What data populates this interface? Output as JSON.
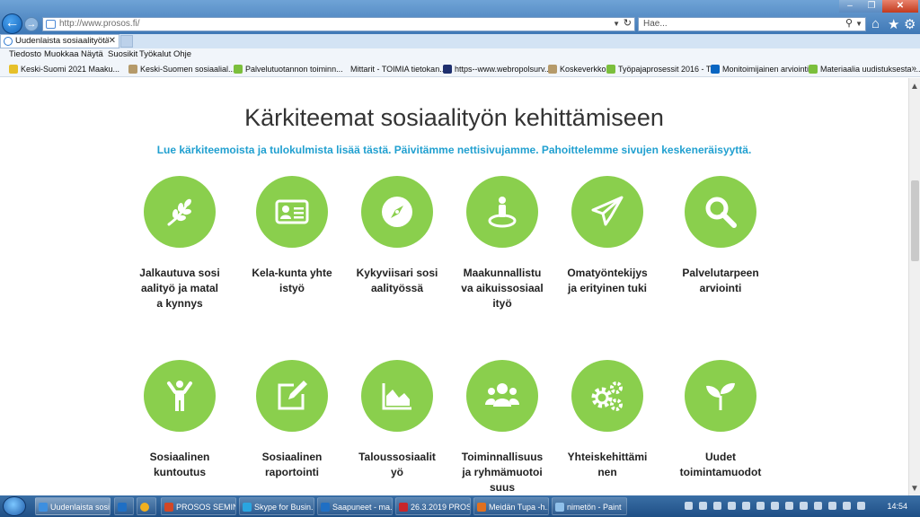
{
  "browser": {
    "url": "http://www.prosos.fi/",
    "search_placeholder": "Hae...",
    "tab_title": "Uudenlaista sosiaalityötä yh...",
    "menu": [
      "Tiedosto",
      "Muokkaa",
      "Näytä",
      "Suosikit",
      "Työkalut",
      "Ohje"
    ],
    "favorites": [
      "Keski-Suomi 2021  Maaku...",
      "Keski-Suomen sosiaalial...",
      "Palvelutuotannon toiminn...",
      "Mittarit - TOIMIA tietokan...",
      "https--www.webropolsurv...",
      "Koskeverkko",
      "Työpajaprosessit 2016 - T...",
      "Monitoimijainen arviointi",
      "Materiaalia uudistuksesta ..."
    ],
    "accent_color": "#3f78b6"
  },
  "page": {
    "heading": "Kärkiteemat sosiaalityön kehittämiseen",
    "intro": "Lue kärkiteemoista ja tulokulmista lisää tästä. Päivitämme nettisivujamme. Pahoittelemme sivujen keskeneräisyyttä.",
    "theme_color": "#8acf4d",
    "intro_color": "#21a0d0",
    "items": [
      {
        "label": "Jalkautuva sosiaalityö ja matala kynnys",
        "icon": "plant-branch-icon"
      },
      {
        "label": "Kela-kunta yhteistyö",
        "icon": "id-card-icon"
      },
      {
        "label": "Kykyviisari sosiaalityössä",
        "icon": "compass-icon"
      },
      {
        "label": "Maakunnallistuva aikuissosiaalityö",
        "icon": "person-location-icon"
      },
      {
        "label": "Omatyöntekijys ja erityinen tuki",
        "icon": "paper-plane-icon"
      },
      {
        "label": "Palvelutarpeen arviointi",
        "icon": "magnifier-icon"
      },
      {
        "label": "Sosiaalinen kuntoutus",
        "icon": "person-arms-up-icon"
      },
      {
        "label": "Sosiaalinen raportointi",
        "icon": "edit-icon"
      },
      {
        "label": "Taloussosiaalityö",
        "icon": "area-chart-icon"
      },
      {
        "label": "Toiminnallisuus ja ryhmämuotoisuus",
        "icon": "group-icon"
      },
      {
        "label": "Yhteiskehittäminen",
        "icon": "gears-icon"
      },
      {
        "label": "Uudet toimintamuodot",
        "icon": "sprout-icon"
      }
    ]
  },
  "taskbar": {
    "windows": [
      "Uudenlaista sosi...",
      "PROSOS SEMIN...",
      "Skype for Busin...",
      "Saapuneet - ma...",
      "26.3.2019 PROS...",
      "Meidän Tupa -h...",
      "nimetön - Paint"
    ],
    "clock": "14:54"
  }
}
